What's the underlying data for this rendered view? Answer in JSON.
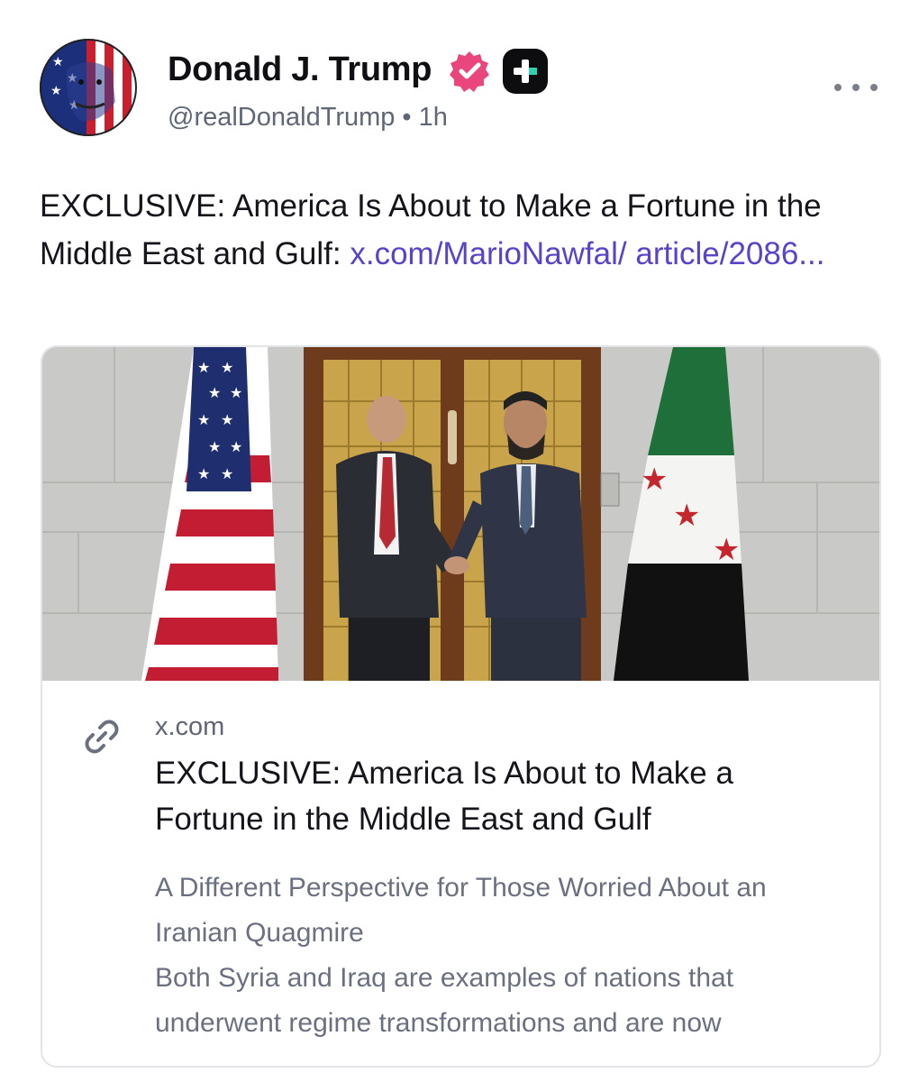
{
  "author": {
    "display_name": "Donald J. Trump",
    "handle": "@realDonaldTrump",
    "separator": "•",
    "time": "1h",
    "avatar_icon": "flag-face-avatar",
    "verified_icon": "verified-badge-icon",
    "verified_color": "#e8467c",
    "plus_icon": "plus-badge-icon"
  },
  "post": {
    "text": "EXCLUSIVE: America Is About to Make a Fortune in the Middle East and Gulf: ",
    "link_text": "x.com/MarioNawfal/ article/2086...",
    "link_color": "#5a42c9"
  },
  "more_icon": "more-options-icon",
  "card": {
    "image_icon": "handshake-photo",
    "link_icon": "link-icon",
    "domain": "x.com",
    "title": "EXCLUSIVE: America Is About to Make a Fortune in the Middle East and Gulf",
    "description_line1": "A Different Perspective for Those Worried About an Iranian Quagmire",
    "description_line2": "Both Syria and Iraq are examples of nations that underwent regime transformations and are now"
  }
}
